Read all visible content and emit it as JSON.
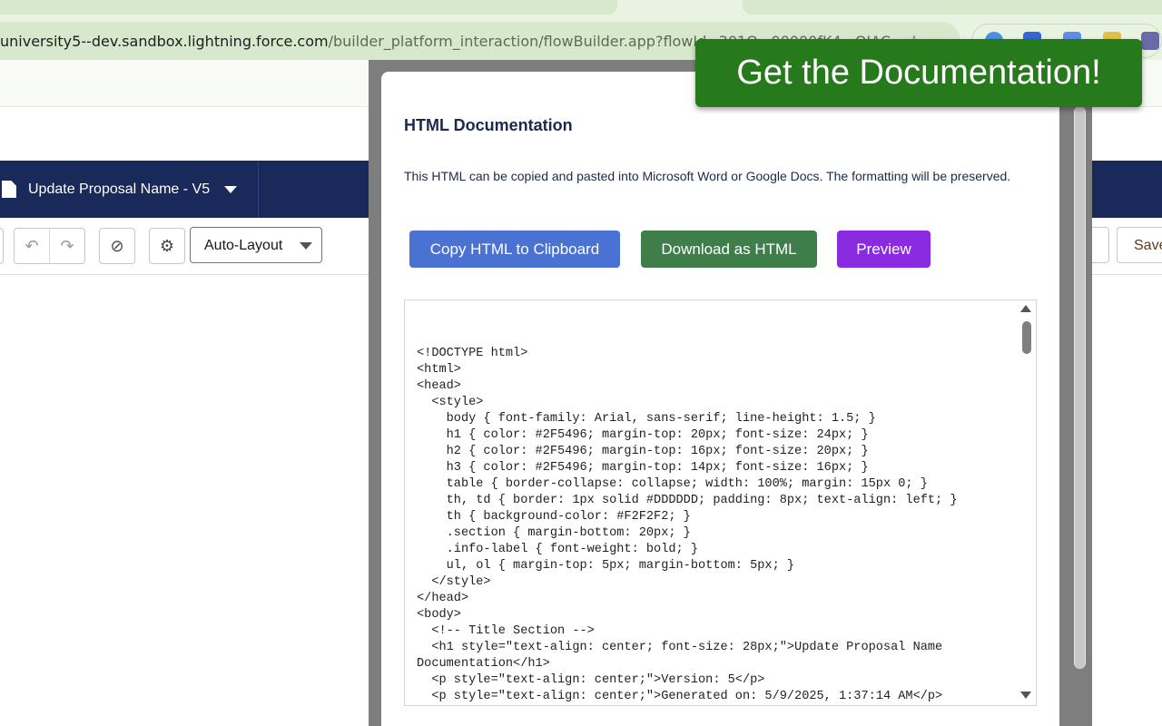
{
  "browser": {
    "url_host": "university5--dev.sandbox.lightning.force.com",
    "url_path": "/builder_platform_interaction/flowBuilder.app?flowId=301O...00000fK4...QIAC",
    "star_icon": "star-icon"
  },
  "flow_builder": {
    "flow_title": "Update Proposal Name - V5",
    "auto_layout_label": "Auto-Layout",
    "save_label": "Save",
    "icons": {
      "file": "file-icon",
      "undo": "undo-icon",
      "redo": "redo-icon",
      "cancel": "cancel-icon",
      "gear": "gear-icon"
    }
  },
  "banner": {
    "text": "Get the Documentation!",
    "color": "#267a1c"
  },
  "modal": {
    "title": "HTML Documentation",
    "description": "This HTML can be copied and pasted into Microsoft Word or Google Docs. The formatting will be preserved.",
    "buttons": {
      "copy": "Copy HTML to Clipboard",
      "download": "Download as HTML",
      "preview": "Preview"
    },
    "button_colors": {
      "copy": "#4a72d2",
      "download": "#3f7d4b",
      "preview": "#8a2be2"
    },
    "code": "<!DOCTYPE html>\n<html>\n<head>\n  <style>\n    body { font-family: Arial, sans-serif; line-height: 1.5; }\n    h1 { color: #2F5496; margin-top: 20px; font-size: 24px; }\n    h2 { color: #2F5496; margin-top: 16px; font-size: 20px; }\n    h3 { color: #2F5496; margin-top: 14px; font-size: 16px; }\n    table { border-collapse: collapse; width: 100%; margin: 15px 0; }\n    th, td { border: 1px solid #DDDDDD; padding: 8px; text-align: left; }\n    th { background-color: #F2F2F2; }\n    .section { margin-bottom: 20px; }\n    .info-label { font-weight: bold; }\n    ul, ol { margin-top: 5px; margin-bottom: 5px; }\n  </style>\n</head>\n<body>\n  <!-- Title Section -->\n  <h1 style=\"text-align: center; font-size: 28px;\">Update Proposal Name Documentation</h1>\n  <p style=\"text-align: center;\">Version: 5</p>\n  <p style=\"text-align: center;\">Generated on: 5/9/2025, 1:37:14 AM</p>"
  }
}
